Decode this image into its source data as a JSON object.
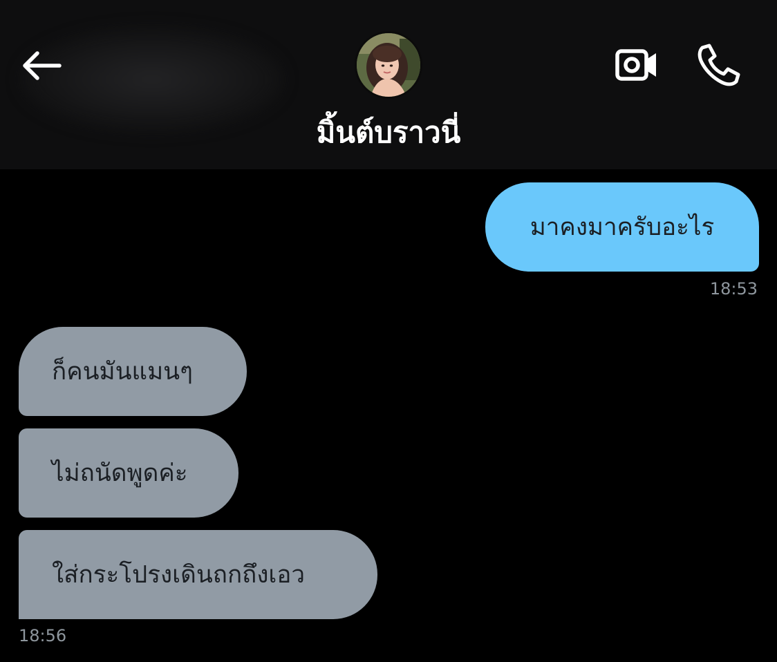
{
  "header": {
    "contact_name": "มิ้นต์บราวนี่",
    "back_icon": "arrow-left-icon",
    "video_icon": "video-camera-icon",
    "call_icon": "phone-icon"
  },
  "messages": [
    {
      "direction": "outgoing",
      "text": "มาคงมาครับอะไร"
    },
    {
      "direction": "incoming",
      "text": "ก็คนมันแมนๆ"
    },
    {
      "direction": "incoming",
      "text": "ไม่ถนัดพูดค่ะ"
    },
    {
      "direction": "incoming",
      "text": "ใส่กระโปรงเดินถกถึงเอว"
    }
  ],
  "timestamps": {
    "outgoing_time": "18:53",
    "incoming_time": "18:56"
  },
  "colors": {
    "background": "#000000",
    "header_background": "#0e0e0f",
    "outgoing_bubble": "#6ac8fb",
    "incoming_bubble": "#919ba5",
    "timestamp_text": "#8e969d"
  }
}
